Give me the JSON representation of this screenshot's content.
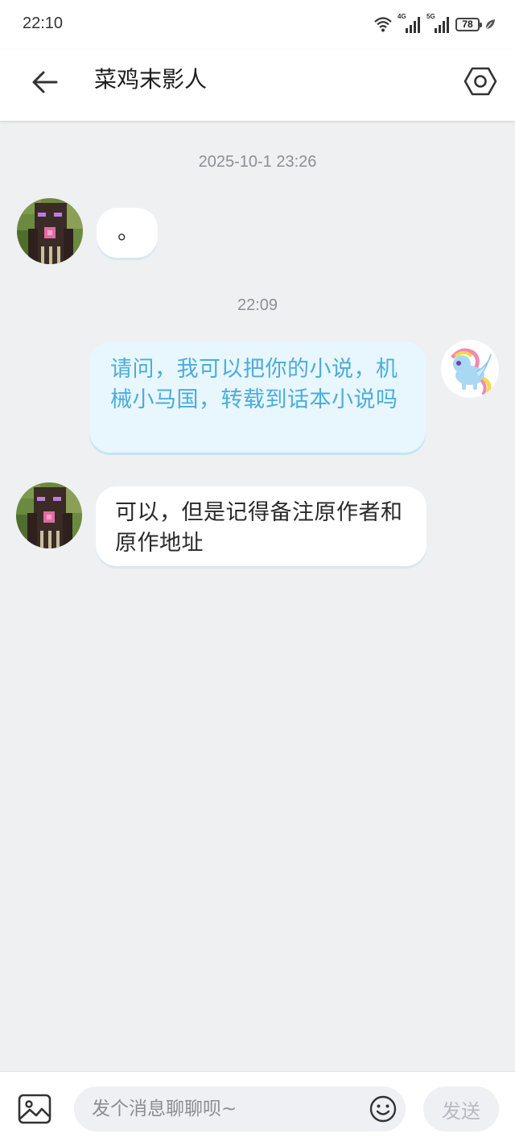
{
  "status_bar": {
    "time": "22:10",
    "network_1": "4G",
    "network_2": "5G",
    "battery": "78"
  },
  "header": {
    "title": "菜鸡末影人"
  },
  "messages": [
    {
      "timestamp": "2025-10-1 23:26"
    },
    {
      "sender": "contact",
      "text": "。"
    },
    {
      "timestamp": "22:09"
    },
    {
      "sender": "me",
      "text": "请问，我可以把你的小说，机械小马国，转载到话本小说吗"
    },
    {
      "sender": "contact",
      "text": "可以，但是记得备注原作者和原作地址"
    }
  ],
  "composer": {
    "placeholder": "发个消息聊聊呗~",
    "send_label": "发送"
  },
  "colors": {
    "background": "#eff0f2",
    "outgoing_bubble": "#e8f6fd",
    "outgoing_text": "#49aedb",
    "incoming_bubble": "#ffffff"
  }
}
